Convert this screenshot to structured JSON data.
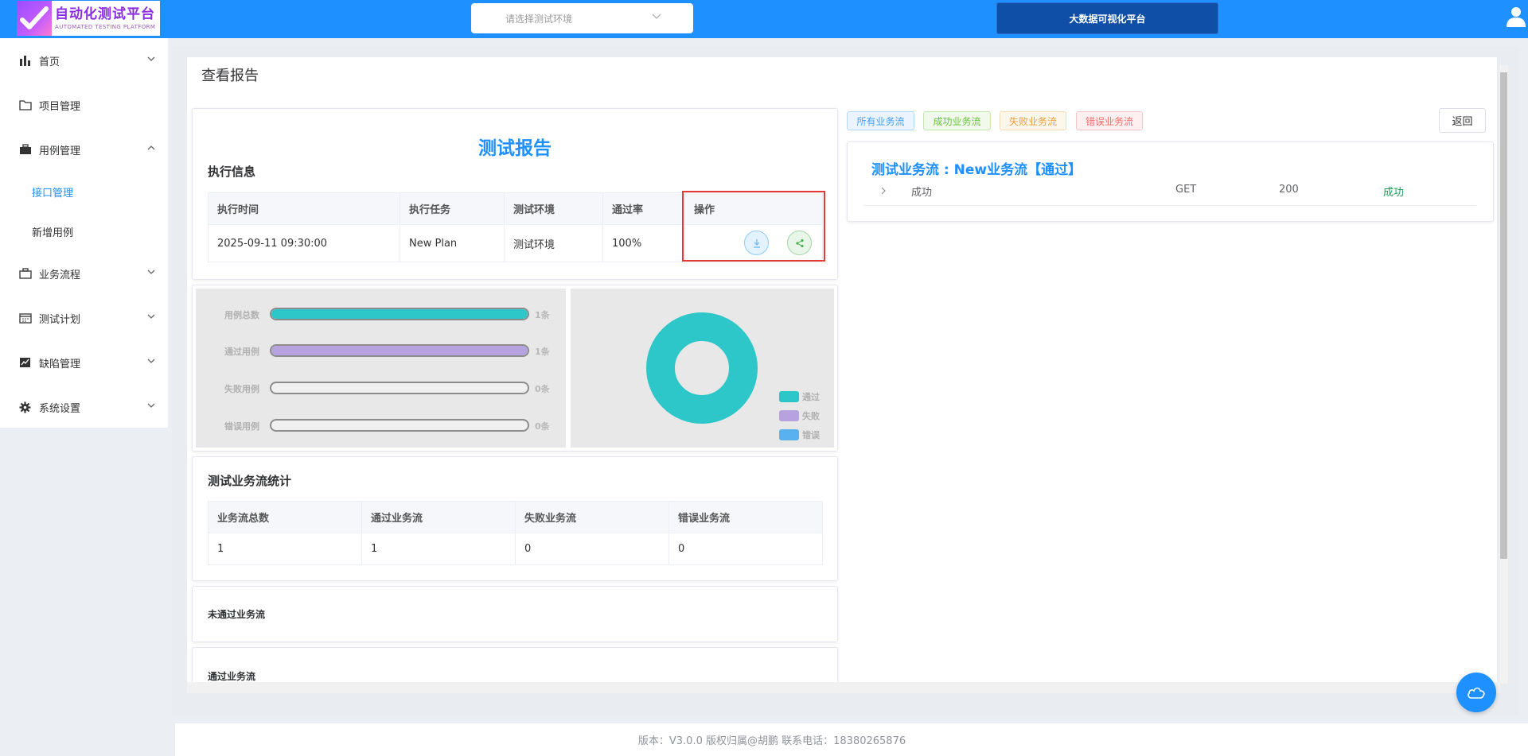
{
  "header": {
    "logo_title": "自动化测试平台",
    "logo_sub": "AUTOMATED TESTING PLATFORM",
    "env_placeholder": "请选择测试环境",
    "bigdata_label": "大数据可视化平台"
  },
  "sidebar": {
    "items": [
      {
        "label": "首页",
        "icon": "bar-chart-icon"
      },
      {
        "label": "项目管理",
        "icon": "folder-icon"
      },
      {
        "label": "用例管理",
        "icon": "briefcase-icon"
      },
      {
        "label": "业务流程",
        "icon": "suitcase-icon"
      },
      {
        "label": "测试计划",
        "icon": "calendar-icon"
      },
      {
        "label": "缺陷管理",
        "icon": "line-chart-icon"
      },
      {
        "label": "系统设置",
        "icon": "gear-icon"
      }
    ],
    "sub_items": [
      {
        "label": "接口管理",
        "active": true
      },
      {
        "label": "新增用例",
        "active": false
      }
    ]
  },
  "page": {
    "title": "查看报告",
    "report_title": "测试报告",
    "exec_info_title": "执行信息"
  },
  "exec_table": {
    "headers": [
      "执行时间",
      "执行任务",
      "测试环境",
      "通过率",
      "操作"
    ],
    "row": [
      "2025-09-11 09:30:00",
      "New Plan",
      "测试环境",
      "100%"
    ]
  },
  "chart_data": [
    {
      "type": "bar",
      "categories": [
        "用例总数",
        "通过用例",
        "失败用例",
        "错误用例"
      ],
      "values": [
        1,
        1,
        0,
        0
      ],
      "value_labels": [
        "1条",
        "1条",
        "0条",
        "0条"
      ],
      "colors": [
        "#2ec7c9",
        "#b6a2de",
        "#ffffff",
        "#ffffff"
      ]
    },
    {
      "type": "pie",
      "labels": [
        "通过",
        "失败",
        "错误"
      ],
      "values": [
        1,
        0,
        0
      ],
      "colors": [
        "#2ec7c9",
        "#b6a2de",
        "#5ab1ef"
      ]
    }
  ],
  "flow_stats": {
    "title": "测试业务流统计",
    "headers": [
      "业务流总数",
      "通过业务流",
      "失败业务流",
      "错误业务流"
    ],
    "row": [
      "1",
      "1",
      "0",
      "0"
    ]
  },
  "sections": {
    "failed_flows": "未通过业务流",
    "passed_flows": "通过业务流"
  },
  "filter_tags": [
    {
      "label": "所有业务流",
      "color": "#409eff",
      "bg": "#ecf5ff",
      "border": "#b3d8ff"
    },
    {
      "label": "成功业务流",
      "color": "#67c23a",
      "bg": "#f0f9eb",
      "border": "#c2e7b0"
    },
    {
      "label": "失败业务流",
      "color": "#e6a23c",
      "bg": "#fdf6ec",
      "border": "#f5dab1"
    },
    {
      "label": "错误业务流",
      "color": "#f56c6c",
      "bg": "#fef0f0",
      "border": "#fbc4c4"
    }
  ],
  "back_label": "返回",
  "flow_detail": {
    "title": "测试业务流 : New业务流【通过】",
    "row": {
      "name": "成功",
      "method": "GET",
      "code": "200",
      "result": "成功"
    }
  },
  "footer": "版本：V3.0.0 版权归属@胡鹏 联系电话：18380265876"
}
